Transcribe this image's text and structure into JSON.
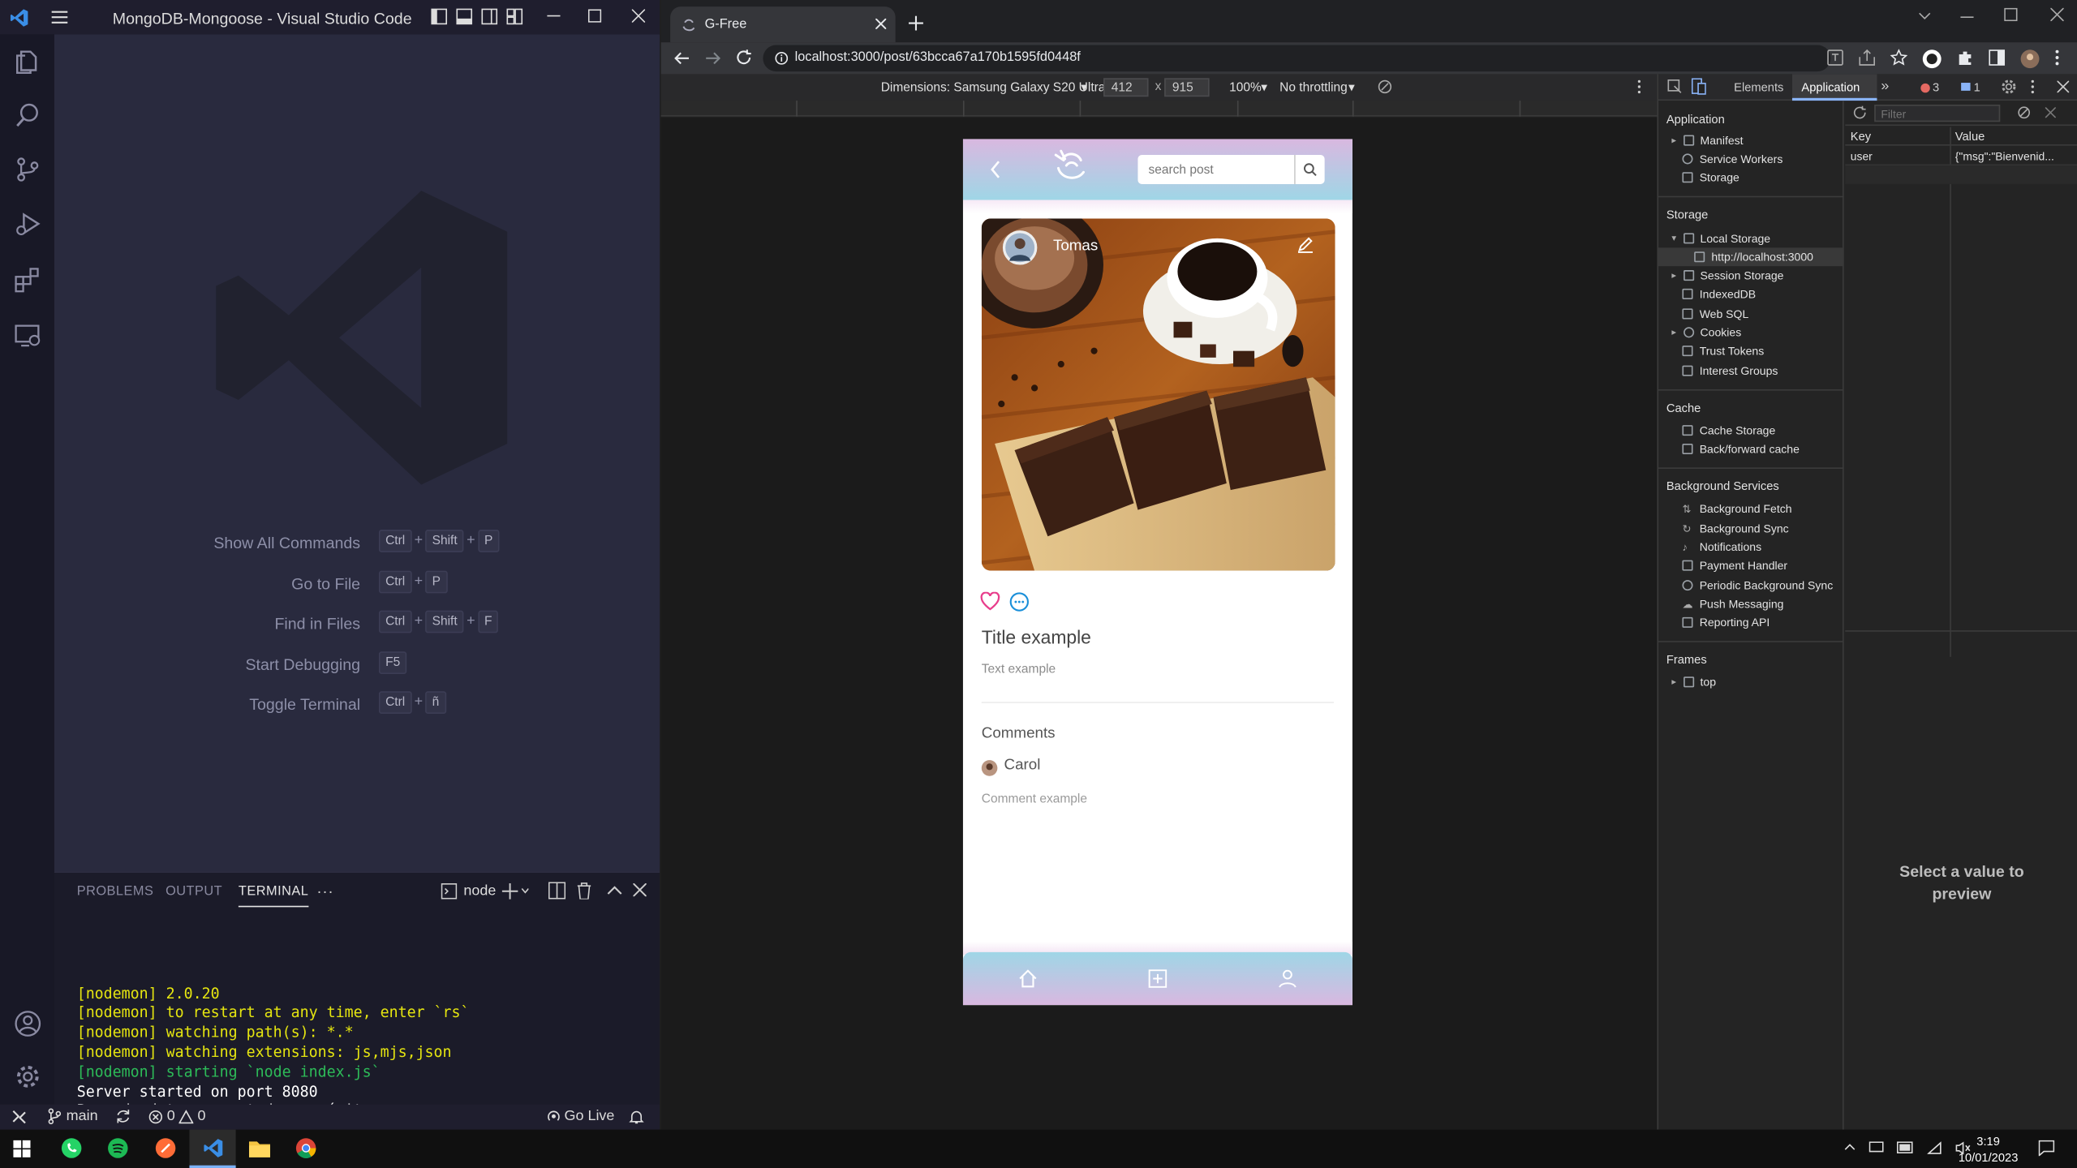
{
  "vscode": {
    "title": "MongoDB-Mongoose - Visual Studio Code",
    "commands": [
      {
        "label": "Show All Commands",
        "keys": [
          "Ctrl",
          "+",
          "Shift",
          "+",
          "P"
        ]
      },
      {
        "label": "Go to File",
        "keys": [
          "Ctrl",
          "+",
          "P"
        ]
      },
      {
        "label": "Find in Files",
        "keys": [
          "Ctrl",
          "+",
          "Shift",
          "+",
          "F"
        ]
      },
      {
        "label": "Start Debugging",
        "keys": [
          "F5"
        ]
      },
      {
        "label": "Toggle Terminal",
        "keys": [
          "Ctrl",
          "+",
          "ñ"
        ]
      }
    ],
    "panel_tabs": {
      "problems": "PROBLEMS",
      "output": "OUTPUT",
      "terminal": "TERMINAL",
      "more": "···"
    },
    "terminal_name": "node",
    "terminal_lines": [
      {
        "text": "[nodemon] 2.0.20",
        "color": "#e5e510"
      },
      {
        "text": "[nodemon] to restart at any time, enter `rs`",
        "color": "#e5e510"
      },
      {
        "text": "[nodemon] watching path(s): *.*",
        "color": "#e5e510"
      },
      {
        "text": "[nodemon] watching extensions: js,mjs,json",
        "color": "#e5e510"
      },
      {
        "text": "[nodemon] starting `node index.js`",
        "color": "#2dbb58"
      },
      {
        "text": "Server started on port 8080",
        "color": "#ffffff"
      },
      {
        "text": "Base de datos conectada con éxito",
        "color": "#ffffff"
      }
    ],
    "status": {
      "branch": "main",
      "errors": "0",
      "warnings": "0",
      "golive": "Go Live"
    }
  },
  "chrome": {
    "tab_title": "G-Free",
    "url": "localhost:3000/post/63bcca67a170b1595fd0448f",
    "device_label": "Dimensions: Samsung Galaxy S20 Ultra",
    "width_value": "412",
    "height_value": "915",
    "times": "x",
    "zoom": "100%",
    "throttling": "No throttling"
  },
  "app": {
    "search_placeholder": "search post",
    "author": "Tomas",
    "title": "Title example",
    "text": "Text example",
    "comments_heading": "Comments",
    "commenter": "Carol",
    "comment": "Comment example"
  },
  "devtools": {
    "tabs": {
      "elements": "Elements",
      "application": "Application",
      "errors": "3",
      "messages": "1"
    },
    "filter_placeholder": "Filter",
    "table": {
      "key_header": "Key",
      "value_header": "Value",
      "key": "user",
      "value": "{\"msg\":\"Bienvenid..."
    },
    "preview": "Select a value to preview",
    "sections": {
      "application": {
        "title": "Application",
        "items": [
          "Manifest",
          "Service Workers",
          "Storage"
        ]
      },
      "storage": {
        "title": "Storage",
        "items": [
          "Local Storage",
          "http://localhost:3000",
          "Session Storage",
          "IndexedDB",
          "Web SQL",
          "Cookies",
          "Trust Tokens",
          "Interest Groups"
        ]
      },
      "cache": {
        "title": "Cache",
        "items": [
          "Cache Storage",
          "Back/forward cache"
        ]
      },
      "background": {
        "title": "Background Services",
        "items": [
          "Background Fetch",
          "Background Sync",
          "Notifications",
          "Payment Handler",
          "Periodic Background Sync",
          "Push Messaging",
          "Reporting API"
        ]
      },
      "frames": {
        "title": "Frames",
        "items": [
          "top"
        ]
      }
    }
  },
  "taskbar": {
    "time": "3:19",
    "date": "10/01/2023"
  },
  "colors": {
    "accent_pink": "#e83e8c",
    "accent_blue": "#1a8fd9",
    "vscode_blue": "#3a8ee6"
  }
}
